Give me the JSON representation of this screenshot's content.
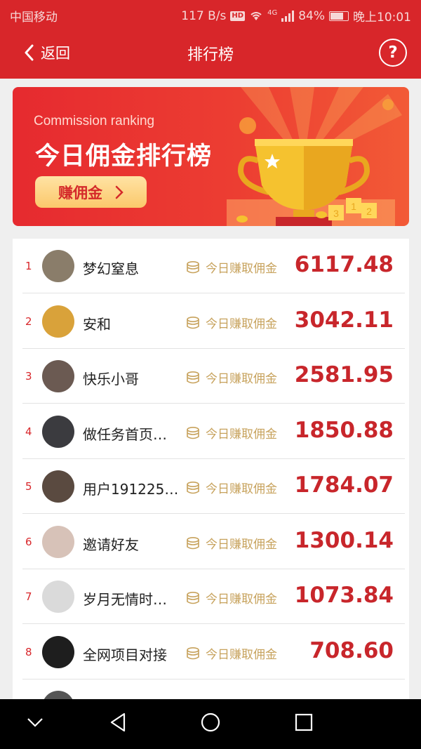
{
  "status": {
    "carrier": "中国移动",
    "speed": "117 B/s",
    "hd": "HD",
    "net": "4G",
    "battery": "84%",
    "battery_level": 0.84,
    "time": "晚上10:01"
  },
  "header": {
    "back_label": "返回",
    "title": "排行榜",
    "help_label": "?"
  },
  "banner": {
    "subtitle": "Commission ranking",
    "title": "今日佣金排行榜",
    "button_label": "赚佣金"
  },
  "ranking": [
    {
      "rank": "1",
      "name": "梦幻窒息",
      "label": "今日赚取佣金",
      "amount": "6117.48",
      "avatar_color": "#8a7d6a"
    },
    {
      "rank": "2",
      "name": "安和",
      "label": "今日赚取佣金",
      "amount": "3042.11",
      "avatar_color": "#d9a23a"
    },
    {
      "rank": "3",
      "name": "快乐小哥",
      "label": "今日赚取佣金",
      "amount": "2581.95",
      "avatar_color": "#6b5a52"
    },
    {
      "rank": "4",
      "name": "做任务首页…",
      "label": "今日赚取佣金",
      "amount": "1850.88",
      "avatar_color": "#3b3b3f"
    },
    {
      "rank": "5",
      "name": "用户191225…",
      "label": "今日赚取佣金",
      "amount": "1784.07",
      "avatar_color": "#5a4a40"
    },
    {
      "rank": "6",
      "name": "邀请好友",
      "label": "今日赚取佣金",
      "amount": "1300.14",
      "avatar_color": "#d7c2b8"
    },
    {
      "rank": "7",
      "name": "岁月无情时…",
      "label": "今日赚取佣金",
      "amount": "1073.84",
      "avatar_color": "#dadada"
    },
    {
      "rank": "8",
      "name": "全网项目对接",
      "label": "今日赚取佣金",
      "amount": "708.60",
      "avatar_color": "#1e1e1e"
    }
  ],
  "colors": {
    "brand_red": "#d8262a",
    "amount_red": "#c8262b",
    "label_gold": "#c7a25c"
  }
}
